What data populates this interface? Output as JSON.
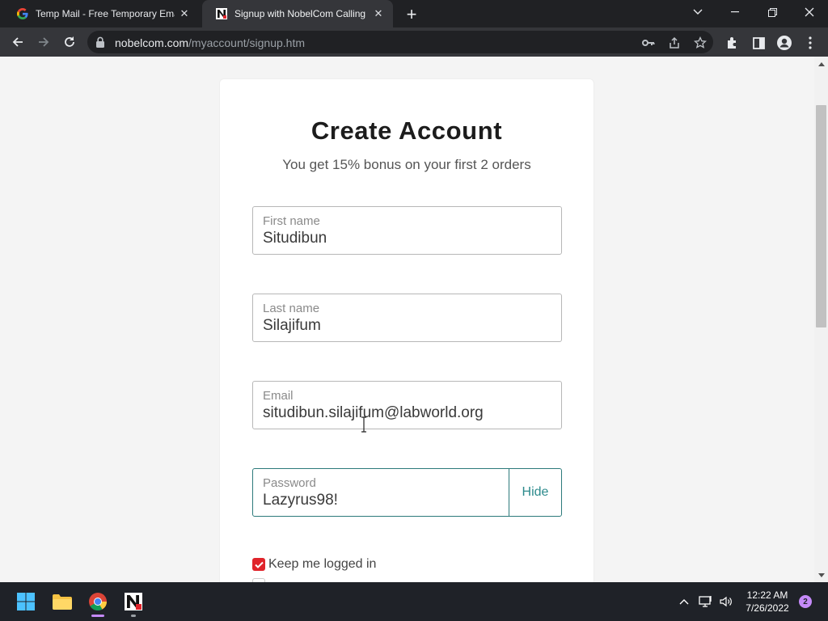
{
  "browser": {
    "tabs": [
      {
        "title": "Temp Mail - Free Temporary Ema",
        "favicon": "google-g-icon",
        "active": false
      },
      {
        "title": "Signup with NobelCom Calling P",
        "favicon": "nobelcom-n-icon",
        "active": true
      }
    ],
    "url_domain": "nobelcom.com",
    "url_path": "/myaccount/signup.htm"
  },
  "page": {
    "title": "Create Account",
    "subtitle": "You get 15% bonus on your first 2 orders",
    "fields": {
      "first_name": {
        "label": "First name",
        "value": "Situdibun"
      },
      "last_name": {
        "label": "Last name",
        "value": "Silajifum"
      },
      "email": {
        "label": "Email",
        "value": "situdibun.silajifum@labworld.org"
      },
      "password": {
        "label": "Password",
        "value": "Lazyrus98!",
        "toggle_label": "Hide"
      }
    },
    "keep_logged_in": {
      "label": "Keep me logged in",
      "checked": true
    },
    "promo_checkbox": {
      "checked": false
    }
  },
  "taskbar": {
    "time": "12:22 AM",
    "date": "7/26/2022",
    "notification_count": "2"
  },
  "colors": {
    "accent_teal": "#2c7a7b",
    "checkbox_red": "#e0242b",
    "chrome_dark": "#202124",
    "chrome_toolbar": "#35363a"
  }
}
